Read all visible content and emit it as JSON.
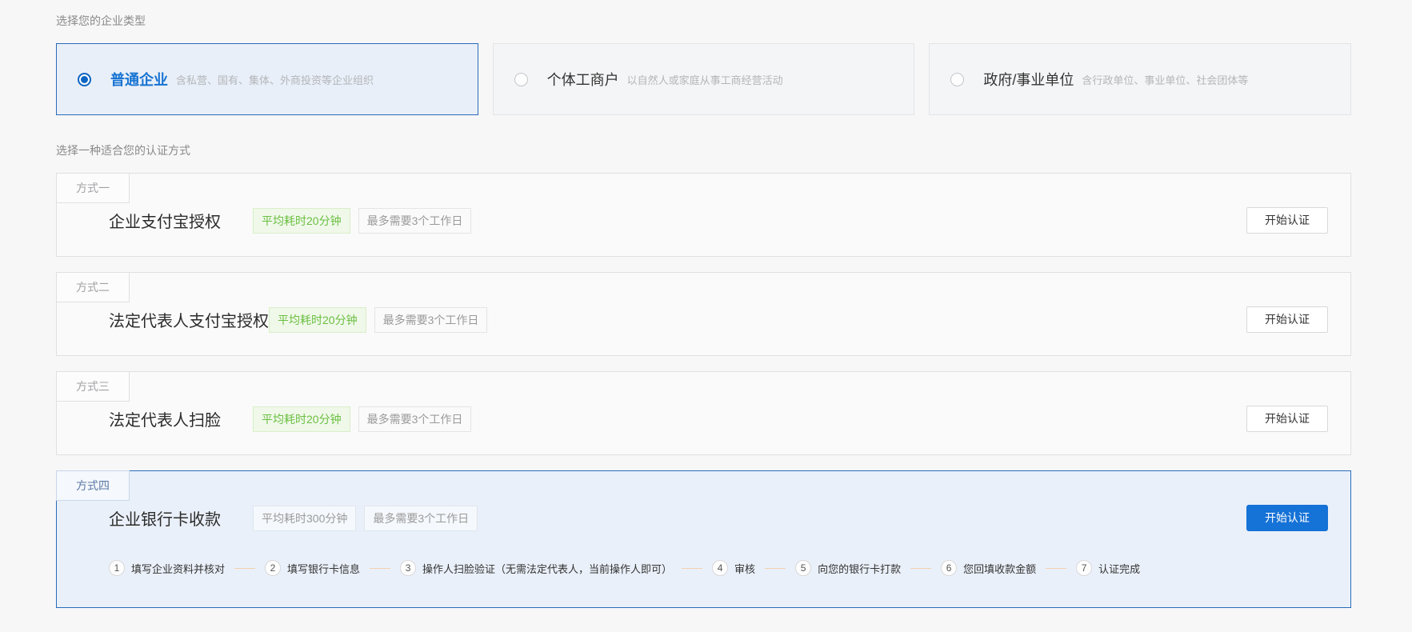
{
  "colors": {
    "accent_blue": "#1572d6",
    "selected_border": "#2a6bb8",
    "selected_bg": "#eaf0f9",
    "badge_green_text": "#6abf40",
    "page_bg": "#f7f7f8"
  },
  "enterprise_type": {
    "label": "选择您的企业类型",
    "options": [
      {
        "title": "普通企业",
        "desc": "含私营、国有、集体、外商投资等企业组织",
        "selected": true
      },
      {
        "title": "个体工商户",
        "desc": "以自然人或家庭从事工商经营活动",
        "selected": false
      },
      {
        "title": "政府/事业单位",
        "desc": "含行政单位、事业单位、社会团体等",
        "selected": false
      }
    ]
  },
  "auth_method": {
    "label": "选择一种适合您的认证方式",
    "start_button_label": "开始认证",
    "methods": [
      {
        "tab": "方式一",
        "title": "企业支付宝授权",
        "time_badge": "平均耗时20分钟",
        "time_badge_style": "green",
        "duration_badge": "最多需要3个工作日",
        "selected": false
      },
      {
        "tab": "方式二",
        "title": "法定代表人支付宝授权",
        "time_badge": "平均耗时20分钟",
        "time_badge_style": "green",
        "duration_badge": "最多需要3个工作日",
        "selected": false
      },
      {
        "tab": "方式三",
        "title": "法定代表人扫脸",
        "time_badge": "平均耗时20分钟",
        "time_badge_style": "green",
        "duration_badge": "最多需要3个工作日",
        "selected": false
      },
      {
        "tab": "方式四",
        "title": "企业银行卡收款",
        "time_badge": "平均耗时300分钟",
        "time_badge_style": "gray",
        "duration_badge": "最多需要3个工作日",
        "selected": true,
        "steps": [
          {
            "num": "1",
            "label": "填写企业资料并核对"
          },
          {
            "num": "2",
            "label": "填写银行卡信息"
          },
          {
            "num": "3",
            "label": "操作人扫脸验证（无需法定代表人，当前操作人即可）"
          },
          {
            "num": "4",
            "label": "审核"
          },
          {
            "num": "5",
            "label": "向您的银行卡打款"
          },
          {
            "num": "6",
            "label": "您回填收款金额"
          },
          {
            "num": "7",
            "label": "认证完成"
          }
        ]
      }
    ]
  }
}
